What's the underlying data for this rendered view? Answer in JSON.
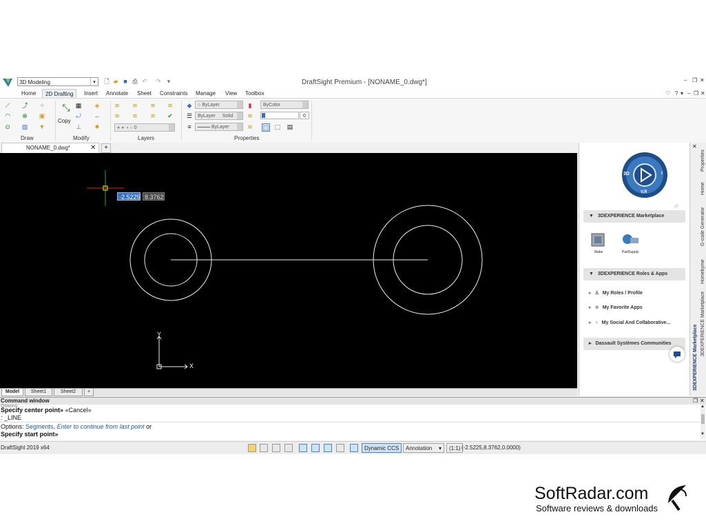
{
  "app": {
    "title": "DraftSight Premium - [NONAME_0.dwg*]",
    "workspace": "3D Modeling"
  },
  "menu_tabs": [
    "Home",
    "2D Drafting",
    "Insert",
    "Annotate",
    "Sheet",
    "Constraints",
    "Manage",
    "View",
    "Toolbox"
  ],
  "ribbon": {
    "groups": [
      "Draw",
      "Modify",
      "Layers",
      "Properties"
    ],
    "copy_label": "Copy",
    "layer_state": "0",
    "layer_combo_1": "ByLayer",
    "layer_combo_2": "ByLayer",
    "layer_combo_2_style": "Solid",
    "layer_combo_3": "ByLayer",
    "color_combo": "ByColor",
    "transparency": "0"
  },
  "document_tab": "NONAME_0.dwg*",
  "canvas": {
    "coord_x": "-2.5225",
    "coord_y": "8.3762",
    "axis_y": "Y",
    "axis_x": "X"
  },
  "sheet_tabs": [
    "Model",
    "Sheet1",
    "Sheet2"
  ],
  "right_panel": {
    "compass_3d": "3D",
    "compass_vr": "V.R",
    "compass_i": "i",
    "sections": [
      {
        "title": "3DEXPERIENCE Marketplace"
      },
      {
        "title": "3DEXPERIENCE Roles & Apps"
      },
      {
        "title": "Dassault Systèmes Communities"
      }
    ],
    "marketplace_apps": [
      "Make",
      "PartSupply"
    ],
    "roles_items": [
      "My Roles / Profile",
      "My Favorite Apps",
      "My Social And Collaborative..."
    ],
    "vertical_tabs": [
      "Properties",
      "Home",
      "G-code Generator",
      "Homebyme",
      "3DEXPERIENCE Marketplace"
    ],
    "vertical_title": "3DEXPERIENCE Marketplace"
  },
  "command_window": {
    "title": "Command window",
    "line0": "Options: ...",
    "line1_bold": "Specify center point»",
    "line1_rest": " «Cancel»",
    "line2": ": _LINE",
    "line3_prefix": "Options: ",
    "line3_opt1": "Segments",
    "line3_sep": ", ",
    "line3_opt2": "Enter to continue from last point",
    "line3_suffix": " or",
    "line4_bold": "Specify start point»"
  },
  "status_bar": {
    "version": "DraftSight 2019 x64",
    "dynamic_ccs": "Dynamic CCS",
    "annotation": "Annotation",
    "scale": "(1:1)",
    "coords": "(-2.5225,8.3762,0.0000)"
  },
  "watermark": {
    "brand": "SoftRadar.com",
    "tagline": "Software reviews & downloads"
  },
  "colors": {
    "canvas": "#000000",
    "accent": "#1a5ab6"
  }
}
